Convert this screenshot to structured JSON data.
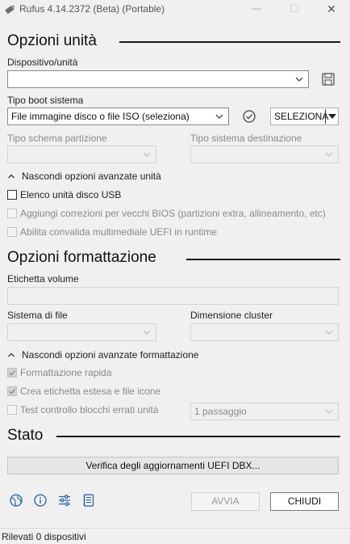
{
  "window": {
    "title": "Rufus 4.14.2372 (Beta) (Portable)",
    "minimize_glyph": "—",
    "maximize_glyph": "☐",
    "close_glyph": "✕"
  },
  "drive": {
    "section_title": "Opzioni unità",
    "device_label": "Dispositivo/unità",
    "device_value": "",
    "boot_label": "Tipo boot sistema",
    "boot_value": "File immagine disco o file ISO (seleziona)",
    "select_button": "SELEZIONA",
    "partition_label": "Tipo schema partizione",
    "partition_value": "",
    "target_label": "Tipo sistema destinazione",
    "target_value": "",
    "advanced_toggle": "Nascondi opzioni avanzate unità",
    "opt_usb_list": "Elenco unità disco USB",
    "opt_bios_fixes": "Aggiungi correzioni per vecchi BIOS (partizioni extra, allineamento, etc)",
    "opt_uefi_validation": "Abilita convalida multimediale UEFI in runtime"
  },
  "format": {
    "section_title": "Opzioni formattazione",
    "volume_label": "Etichetta volume",
    "volume_value": "",
    "fs_label": "Sistema di file",
    "fs_value": "",
    "cluster_label": "Dimensione cluster",
    "cluster_value": "",
    "advanced_toggle": "Nascondi opzioni avanzate formattazione",
    "opt_quick": "Formattazione rapida",
    "opt_extended_label": "Crea etichetta estesa e file icone",
    "opt_bad_blocks": "Test controllo blocchi errati unità",
    "passes_value": "1 passaggio"
  },
  "status": {
    "section_title": "Stato",
    "progress_text": "Verifica degli aggiornamenti UEFI DBX...",
    "progress": 0
  },
  "actions": {
    "start_button": "AVVIA",
    "close_button": "CHIUDI"
  },
  "statusbar": {
    "text": "Rilevati 0 dispositivi"
  },
  "colors": {
    "accent": "#0067c0",
    "disabled_text": "#8a8a8a",
    "tool_icon": "#1f5fa8"
  },
  "icons": {
    "app": "rufus-drive-icon",
    "save": "save-icon",
    "check": "check-circle-icon",
    "language": "globe-icon",
    "about": "info-icon",
    "settings": "settings-sliders-icon",
    "log": "log-icon"
  }
}
